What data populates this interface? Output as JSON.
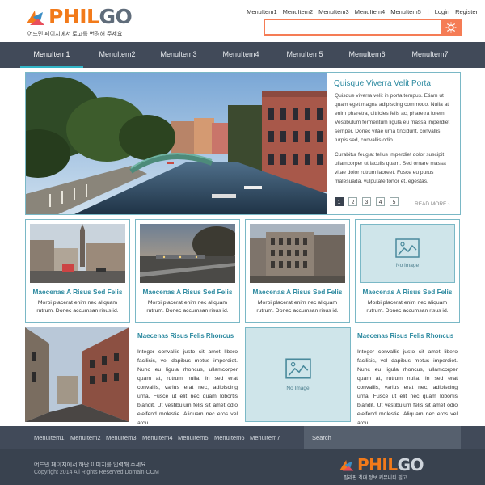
{
  "header": {
    "logo_phil": "PHIL",
    "logo_go": "GO",
    "tagline": "어드민 페이지에서 로고를 변경해 주세요",
    "top_links": [
      "MenuItem1",
      "MenuItem2",
      "MenuItem3",
      "MenuItem4",
      "MenuItem5"
    ],
    "login": "Login",
    "register": "Register",
    "search_value": "",
    "search_icon": "sun-search-icon",
    "accent_color": "#f57c55"
  },
  "nav": {
    "items": [
      "MenuItem1",
      "MenuItem2",
      "MenuItem3",
      "MenuItem4",
      "MenuItem5",
      "MenuItem6",
      "MenuItem7"
    ],
    "active_index": 0,
    "active_color": "#33b5c7"
  },
  "hero": {
    "title": "Quisque Viverra Velit Porta",
    "para1": "Quisque viverra velit in porta tempus. Etiam ut quam eget magna adipiscing commodo. Nulla at enim pharetra, ultricies felis ac, pharetra lorem. Vestibulum fermentum ligula eu massa imperdiet semper. Donec vitae urna tincidunt, convallis turpis sed, convallis odio.",
    "para2": "Curabitur feugiat tellus imperdiet dolor suscipit ullamcorper ut iaculis quam. Sed ornare massa vitae dolor rutrum laoreet. Fusce eu purus malesuada, vulputate tortor et, egestas.",
    "pages": [
      "1",
      "2",
      "3",
      "4",
      "5"
    ],
    "current_page": "1",
    "read_more": "READ MORE"
  },
  "cards": [
    {
      "title": "Maecenas A Risus Sed Felis",
      "desc": "Morbi placerat enim nec aliquam rutrum. Donec accumsan risus id.",
      "image": "city-street-photo"
    },
    {
      "title": "Maecenas A Risus Sed Felis",
      "desc": "Morbi placerat enim nec aliquam rutrum. Donec accumsan risus id.",
      "image": "railway-dusk-photo"
    },
    {
      "title": "Maecenas A Risus Sed Felis",
      "desc": "Morbi placerat enim nec aliquam rutrum. Donec accumsan risus id.",
      "image": "old-building-photo"
    },
    {
      "title": "Maecenas A Risus Sed Felis",
      "desc": "Morbi placerat enim nec aliquam rutrum. Donec accumsan risus id.",
      "image": "no-image",
      "no_image_label": "No Image"
    }
  ],
  "lower": {
    "left": {
      "title": "Maecenas Risus Felis Rhoncus",
      "text": "Integer convallis justo sit amet libero facilisis, vel dapibus metus imperdiet. Nunc eu ligula rhoncus, ullamcorper quam at, rutrum nulla. In sed erat convallis, varius erat nec, adipiscing urna. Fusce ut elit nec quam lobortis blandit. Ut vestibulum felis sit amet odio eleifend molestie. Aliquam nec eros vel arcu"
    },
    "no_image_label": "No Image",
    "right": {
      "title": "Maecenas Risus Felis Rhoncus",
      "text": "Integer convallis justo sit amet libero facilisis, vel dapibus metus imperdiet. Nunc eu ligula rhoncus, ullamcorper quam at, rutrum nulla. In sed erat convallis, varius erat nec, adipiscing urna. Fusce ut elit nec quam lobortis blandit. Ut vestibulum felis sit amet odio eleifend molestie. Aliquam nec eros vel arcu"
    }
  },
  "footer": {
    "nav": [
      "MenuItem1",
      "MenuItem2",
      "MenuItem3",
      "MenuItem4",
      "MenuItem5",
      "MenuItem6",
      "MenuItem7"
    ],
    "search_placeholder": "Search",
    "line1": "어드민 페이지에서 하단 이미지를 입력해 주세요",
    "line2": "Copyright 2014 All Rights Reserved Domain.COM",
    "logo_phil": "PHIL",
    "logo_go": "GO",
    "tagline": "필라핀 최대 정보 커뮤니티 필고"
  }
}
